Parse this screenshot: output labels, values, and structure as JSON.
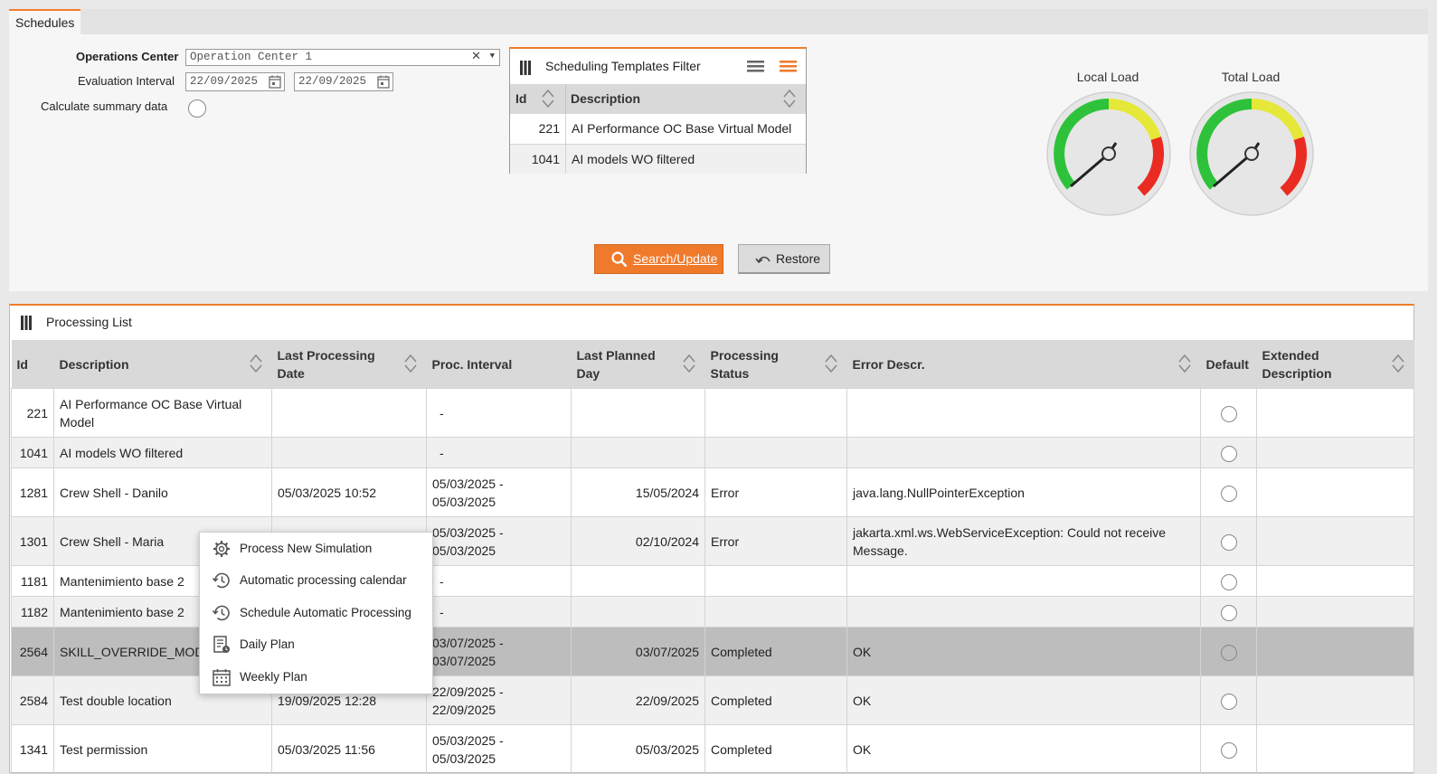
{
  "tab": {
    "label": "Schedules"
  },
  "form": {
    "operations_center_label": "Operations Center",
    "operations_center_value": "Operation Center 1",
    "evaluation_interval_label": "Evaluation Interval",
    "date_from": "22/09/2025",
    "date_to": "22/09/2025",
    "calc_summary_label": "Calculate summary data"
  },
  "filter": {
    "title": "Scheduling Templates Filter",
    "col_id": "Id",
    "col_desc": "Description",
    "rows": [
      {
        "id": "221",
        "desc": "AI Performance OC Base Virtual Model"
      },
      {
        "id": "1041",
        "desc": "AI models WO filtered"
      }
    ]
  },
  "gauges": {
    "local_title": "Local Load",
    "total_title": "Total Load"
  },
  "buttons": {
    "search": "Search/Update",
    "restore": "Restore"
  },
  "plist": {
    "title": "Processing List",
    "headers": {
      "id": "Id",
      "desc": "Description",
      "last_date": "Last Processing Date",
      "interval": "Proc. Interval",
      "planned": "Last Planned Day",
      "status": "Processing Status",
      "error": "Error Descr.",
      "default": "Default",
      "ext": "Extended Description"
    },
    "rows": [
      {
        "id": "221",
        "desc": "AI Performance OC Base Virtual Model",
        "last_date": "",
        "interval": "-",
        "planned": "",
        "status": "",
        "error": ""
      },
      {
        "id": "1041",
        "desc": "AI models WO filtered",
        "last_date": "",
        "interval": "-",
        "planned": "",
        "status": "",
        "error": ""
      },
      {
        "id": "1281",
        "desc": "Crew Shell - Danilo",
        "last_date": "05/03/2025 10:52",
        "interval": "05/03/2025 - 05/03/2025",
        "planned": "15/05/2024",
        "status": "Error",
        "error": "java.lang.NullPointerException"
      },
      {
        "id": "1301",
        "desc": "Crew Shell - Maria",
        "last_date": "",
        "interval": "05/03/2025 - 05/03/2025",
        "planned": "02/10/2024",
        "status": "Error",
        "error": "jakarta.xml.ws.WebServiceException: Could not receive Message."
      },
      {
        "id": "1181",
        "desc": "Mantenimiento base 2",
        "last_date": "",
        "interval": "-",
        "planned": "",
        "status": "",
        "error": ""
      },
      {
        "id": "1182",
        "desc": "Mantenimiento base 2",
        "last_date": "",
        "interval": "-",
        "planned": "",
        "status": "",
        "error": ""
      },
      {
        "id": "2564",
        "desc": "SKILL_OVERRIDE_MODEL",
        "last_date": "",
        "interval": "03/07/2025 - 03/07/2025",
        "planned": "03/07/2025",
        "status": "Completed",
        "error": "OK"
      },
      {
        "id": "2584",
        "desc": "Test double location",
        "last_date": "19/09/2025 12:28",
        "interval": "22/09/2025 - 22/09/2025",
        "planned": "22/09/2025",
        "status": "Completed",
        "error": "OK"
      },
      {
        "id": "1341",
        "desc": "Test permission",
        "last_date": "05/03/2025 11:56",
        "interval": "05/03/2025 - 05/03/2025",
        "planned": "05/03/2025",
        "status": "Completed",
        "error": "OK"
      }
    ]
  },
  "context_menu": {
    "items": [
      {
        "label": "Process New Simulation",
        "icon": "gear-icon"
      },
      {
        "label": "Automatic processing calendar",
        "icon": "history-icon"
      },
      {
        "label": "Schedule Automatic Processing",
        "icon": "history-icon"
      },
      {
        "label": "Daily Plan",
        "icon": "daily-plan-icon"
      },
      {
        "label": "Weekly Plan",
        "icon": "calendar-icon"
      }
    ]
  },
  "colors": {
    "accent": "#ef7a2c",
    "selected_row": "#bdbdbd",
    "header_bg": "#d9d9d9"
  }
}
